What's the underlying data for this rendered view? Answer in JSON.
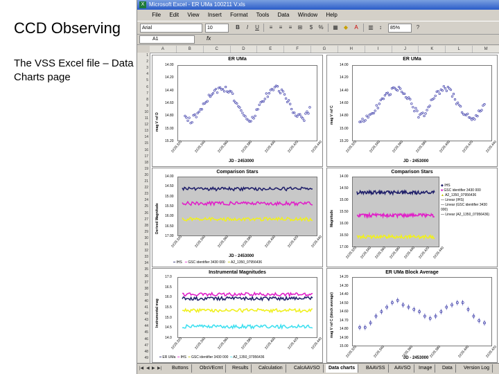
{
  "slide": {
    "title": "CCD Observing",
    "body": "The VSS Excel file – Data Charts page"
  },
  "excel": {
    "window_title": "Microsoft Excel - ER UMa 100211 V.xls",
    "menu": [
      "File",
      "Edit",
      "View",
      "Insert",
      "Format",
      "Tools",
      "Data",
      "Window",
      "Help"
    ],
    "font_name": "Arial",
    "font_size": "10",
    "zoom": "85%",
    "name_box": "A1",
    "fx_label": "fx",
    "columns": [
      "A",
      "B",
      "C",
      "D",
      "E",
      "F",
      "G",
      "H",
      "I",
      "J",
      "K",
      "L",
      "M"
    ],
    "rows": [
      "1",
      "2",
      "3",
      "4",
      "5",
      "6",
      "7",
      "8",
      "9",
      "10",
      "11",
      "12",
      "13",
      "14",
      "15",
      "16",
      "17",
      "18",
      "19",
      "20",
      "21",
      "22",
      "23",
      "24",
      "25",
      "26",
      "27",
      "28",
      "29",
      "30",
      "31",
      "32",
      "33",
      "34",
      "35",
      "36",
      "37",
      "38",
      "39",
      "40",
      "41",
      "42",
      "43",
      "44",
      "45",
      "46",
      "47",
      "48",
      "49"
    ],
    "tabs": [
      "Buttons",
      "ObsVEcmt",
      "Results",
      "Calculation",
      "CalcAAVSO",
      "Data charts",
      "BAAVSS",
      "AAVSO",
      "Image",
      "Data",
      "Version Log"
    ],
    "active_tab": "Data charts"
  },
  "colors": {
    "target": "#3a3aa8",
    "comp_navy": "#20206a",
    "comp_magenta": "#e020c8",
    "comp_yellow": "#f0f020",
    "comp_cyan": "#40e0f0",
    "trend": "#000000"
  },
  "chart_data": [
    {
      "type": "scatter",
      "title": "ER UMa",
      "ylabel": "mag V ref D",
      "xlabel": "JD - 2453000",
      "ylim": [
        15.2,
        14.0
      ],
      "y_ticks": [
        "14.00",
        "14.20",
        "14.40",
        "14.60",
        "14.80",
        "15.00",
        "15.20"
      ],
      "x_ticks": [
        "2229.320",
        "2229.340",
        "2229.360",
        "2229.380",
        "2229.400",
        "2229.420",
        "2229.440"
      ],
      "series": [
        {
          "values": [
            14.9,
            14.95,
            14.85,
            14.7,
            14.55,
            14.4,
            14.35,
            14.3,
            14.35,
            14.5,
            14.7,
            14.9,
            14.95,
            14.8,
            14.6,
            14.45,
            14.35,
            14.3,
            14.4,
            14.55,
            14.75,
            14.85,
            14.9,
            14.7
          ]
        }
      ]
    },
    {
      "type": "scatter",
      "title": "ER UMa",
      "ylabel": "mag V ref C",
      "xlabel": "JD - 2453000",
      "ylim": [
        15.2,
        14.0
      ],
      "y_ticks": [
        "14.00",
        "14.20",
        "14.40",
        "14.60",
        "14.80",
        "15.00",
        "15.20"
      ],
      "x_ticks": [
        "2229.320",
        "2229.340",
        "2229.360",
        "2229.380",
        "2229.400",
        "2229.420",
        "2229.440"
      ],
      "series": [
        {
          "values": [
            14.95,
            14.9,
            14.85,
            14.7,
            14.55,
            14.45,
            14.35,
            14.3,
            14.35,
            14.5,
            14.7,
            14.85,
            14.8,
            14.6,
            14.45,
            14.35,
            14.3,
            14.4,
            14.6,
            14.75,
            14.85,
            14.9,
            14.8,
            14.6
          ]
        }
      ]
    },
    {
      "type": "line",
      "title": "Comparison Stars",
      "ylabel": "Derived Magnitude",
      "xlabel": "JD - 2453000",
      "y_ticks": [
        "14.00",
        "14.50",
        "15.00",
        "15.50",
        "16.00",
        "16.50",
        "17.00"
      ],
      "x_ticks": [
        "2229.320",
        "2229.340",
        "2229.360",
        "2229.380",
        "2229.400",
        "2229.420",
        "2229.440"
      ],
      "legend": [
        "IHS",
        "GSC identifier 3430 000",
        "A2_1350_07956436"
      ],
      "series": [
        {
          "name": "IHS",
          "level": 14.6
        },
        {
          "name": "GSC identifier 3430 000",
          "level": 15.3
        },
        {
          "name": "A2_1350_07956436",
          "level": 16.0
        }
      ]
    },
    {
      "type": "line",
      "title": "Comparison Stars",
      "ylabel": "Magnitude",
      "y_ticks": [
        "14.00",
        "14.50",
        "15.00",
        "15.50",
        "16.00",
        "16.50",
        "17.00"
      ],
      "x_ticks": [
        "2229.320",
        "2229.340",
        "2229.360",
        "2229.380",
        "2229.400",
        "2229.420",
        "2229.440"
      ],
      "legend": [
        "IHS",
        "GSC identifier 3430 000",
        "A2_1350_07956436",
        "Linear (IHS)",
        "Linear (GSC identifier 3430 000)",
        "Linear (A2_1350_07956436)"
      ],
      "series": [
        {
          "name": "IHS",
          "level": 14.5
        },
        {
          "name": "GSC identifier 3430 000",
          "level": 15.4
        },
        {
          "name": "A2_1350_07956436",
          "level": 16.1
        }
      ]
    },
    {
      "type": "line",
      "title": "Instrumental Magnitudes",
      "ylabel": "Instrumental mag",
      "y_ticks": [
        "17.0",
        "16.5",
        "16.0",
        "15.5",
        "15.0",
        "14.5",
        "14.0"
      ],
      "x_ticks": [
        "2229.320",
        "2229.340",
        "2229.360",
        "2229.380",
        "2229.400",
        "2229.420",
        "2229.440"
      ],
      "legend": [
        "ER UMa",
        "IHS",
        "GSC identifier 3430 000",
        "A2_1350_07956436"
      ],
      "series": [
        {
          "name": "ER UMa",
          "level": 16.6
        },
        {
          "name": "IHS",
          "level": 16.2
        },
        {
          "name": "GSC identifier 3430 000",
          "level": 15.5
        },
        {
          "name": "A2_1350_07956436",
          "level": 14.7
        }
      ]
    },
    {
      "type": "scatter",
      "title": "ER UMa Block Average",
      "ylabel": "mag V ref C (block average)",
      "xlabel": "JD - 2453000",
      "y_ticks": [
        "14.20",
        "14.30",
        "14.40",
        "14.50",
        "14.60",
        "14.70",
        "14.80",
        "14.90",
        "15.00"
      ],
      "x_ticks": [
        "2229.320",
        "2229.340",
        "2229.360",
        "2229.380",
        "2229.400",
        "2229.420"
      ],
      "series": [
        {
          "values": [
            14.95,
            14.95,
            14.85,
            14.7,
            14.6,
            14.5,
            14.4,
            14.35,
            14.45,
            14.5,
            14.55,
            14.6,
            14.7,
            14.75,
            14.7,
            14.6,
            14.5,
            14.45,
            14.4,
            14.4,
            14.55,
            14.7,
            14.8,
            14.85
          ]
        }
      ]
    }
  ]
}
